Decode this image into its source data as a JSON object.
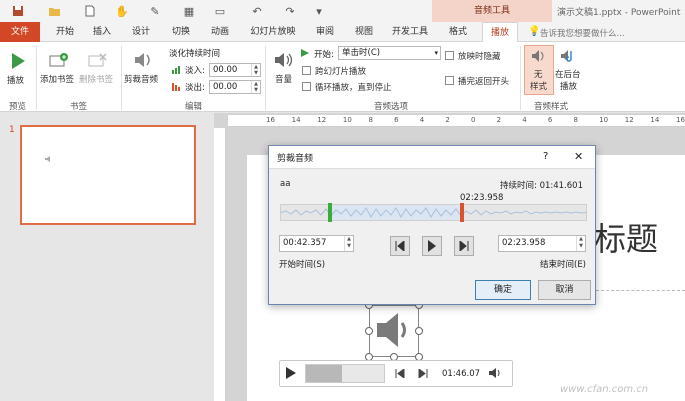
{
  "app": {
    "audio_tools_label": "音频工具",
    "doc_title": "演示文稿1.pptx - PowerPoint"
  },
  "tabs": {
    "file": "文件",
    "home": "开始",
    "insert": "插入",
    "design": "设计",
    "transitions": "切换",
    "animations": "动画",
    "slideshow": "幻灯片放映",
    "review": "审阅",
    "view": "视图",
    "developer": "开发工具",
    "format": "格式",
    "playback": "播放",
    "tell_me": "告诉我您想要做什么..."
  },
  "ribbon": {
    "play_label": "播放",
    "preview_group": "预览",
    "add_bookmark": "添加书签",
    "remove_bookmark": "删除书签",
    "bookmarks_group": "书签",
    "trim_audio": "剪裁音频",
    "fade_duration": "淡化持续时间",
    "fade_in_label": "淡入:",
    "fade_in_value": "00.00",
    "fade_out_label": "淡出:",
    "fade_out_value": "00.00",
    "editing_group": "编辑",
    "volume_label": "音量",
    "start_label": "开始:",
    "start_value": "单击时(C)",
    "play_across_slides": "跨幻灯片播放",
    "loop_until_stopped": "循环播放，直到停止",
    "hide_during_show": "放映时隐藏",
    "rewind_after_play": "播完返回开头",
    "audio_options_group": "音频选项",
    "no_style": "无\n样式",
    "no_style_line1": "无",
    "no_style_line2": "样式",
    "play_in_bg_line1": "在后台",
    "play_in_bg_line2": "播放",
    "audio_styles_group": "音频样式"
  },
  "thumbnail": {
    "slide_number": "1"
  },
  "ruler": {
    "ticks": [
      "16",
      "14",
      "12",
      "10",
      "8",
      "6",
      "4",
      "2",
      "0",
      "2",
      "4",
      "6",
      "8",
      "10",
      "12",
      "14",
      "16"
    ]
  },
  "slide": {
    "title_fragment": "标题"
  },
  "dialog": {
    "title": "剪裁音频",
    "help": "?",
    "file_name": "aa",
    "duration_label": "持续时间: 01:41.601",
    "end_marker_time": "02:23.958",
    "start_time_value": "00:42.357",
    "end_time_value": "02:23.958",
    "start_time_label": "开始时间(S)",
    "end_time_label": "结束时间(E)",
    "ok": "确定",
    "cancel": "取消"
  },
  "player": {
    "time": "01:46.07"
  },
  "watermark": "www.cfan.com.cn",
  "colors": {
    "file_tab": "#d24726",
    "audio_tools_bg": "#f4d4c9",
    "thumb_border": "#e06c4a",
    "start_marker": "#3daa3d",
    "end_marker": "#d9542c",
    "play_button": "#3a9a46"
  }
}
